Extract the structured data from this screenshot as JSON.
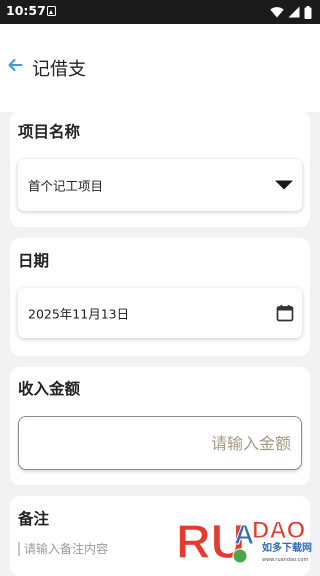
{
  "status_bar": {
    "time": "10:57",
    "icons": [
      "sim-card-icon",
      "wifi-icon",
      "signal-icon",
      "battery-icon"
    ]
  },
  "app_bar": {
    "back_icon": "arrow-back-icon",
    "title": "记借支"
  },
  "project": {
    "label": "项目名称",
    "selected": "首个记工项目",
    "dropdown_icon": "dropdown-arrow-icon"
  },
  "date": {
    "label": "日期",
    "value": "2025年11月13日",
    "icon": "calendar-icon"
  },
  "income": {
    "label": "收入金额",
    "placeholder": "请输入金额",
    "value": ""
  },
  "note": {
    "label": "备注",
    "placeholder": "请输入备注内容"
  },
  "watermark": {
    "brand": "RUANDAO",
    "tagline": "如多下载网",
    "url": "www.ruandao.com"
  },
  "colors": {
    "background": "#f2f2f4",
    "status_bar": "#1b1b1b",
    "back_arrow": "#3c9bd6",
    "placeholder": "#a39a86",
    "watermark_red": "#e53a2f",
    "watermark_blue": "#2f6db5",
    "watermark_green": "#4aa84a"
  }
}
